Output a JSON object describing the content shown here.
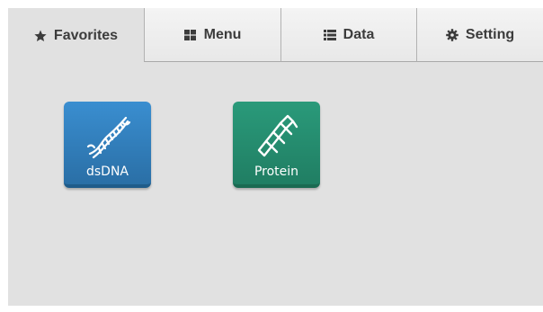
{
  "tabs": [
    {
      "label": "Favorites",
      "icon": "star-icon",
      "active": true
    },
    {
      "label": "Menu",
      "icon": "grid-icon",
      "active": false
    },
    {
      "label": "Data",
      "icon": "list-icon",
      "active": false
    },
    {
      "label": "Setting",
      "icon": "gear-icon",
      "active": false
    }
  ],
  "apps": [
    {
      "label": "dsDNA",
      "icon": "dna-helix-icon",
      "color": "#2f7fbf"
    },
    {
      "label": "Protein",
      "icon": "protein-helix-icon",
      "color": "#248a6d"
    }
  ]
}
